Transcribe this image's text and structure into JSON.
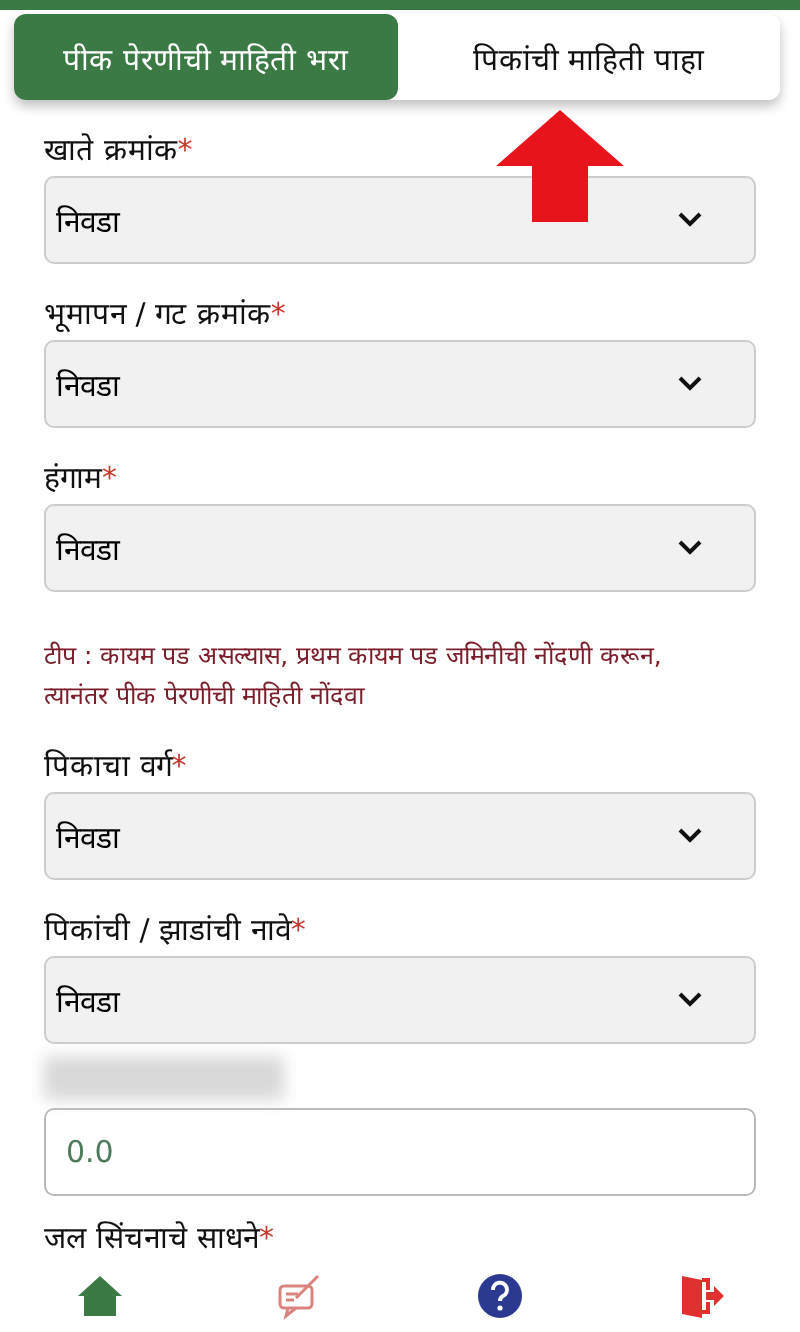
{
  "tabs": [
    {
      "label": "पीक पेरणीची माहिती भरा",
      "selected": true
    },
    {
      "label": "पिकांची माहिती पाहा",
      "selected": false
    }
  ],
  "form": [
    {
      "kind": "select",
      "label": "खाते क्रमांक",
      "required_mark": "*",
      "value": "निवडा"
    },
    {
      "kind": "select",
      "label": "भूमापन / गट क्रमांक",
      "required_mark": "*",
      "value": "निवडा"
    },
    {
      "kind": "select",
      "label": "हंगाम",
      "required_mark": "*",
      "value": "निवडा"
    },
    {
      "kind": "note",
      "text": "टीप : कायम पड असल्यास, प्रथम कायम पड जमिनीची नोंदणी करून, त्यानंतर पीक पेरणीची माहिती नोंदवा"
    },
    {
      "kind": "select",
      "label": "पिकाचा वर्ग",
      "required_mark": "*",
      "value": "निवडा"
    },
    {
      "kind": "select",
      "label": "पिकांची / झाडांची नावे",
      "required_mark": "*",
      "value": "निवडा"
    },
    {
      "kind": "blur"
    },
    {
      "kind": "input",
      "value": "0.0"
    },
    {
      "kind": "label",
      "label": "जल सिंचनाचे साधने",
      "required_mark": "*"
    }
  ],
  "bottom_nav": [
    {
      "kind": "home"
    },
    {
      "kind": "survey"
    },
    {
      "kind": "help"
    },
    {
      "kind": "logout"
    }
  ]
}
